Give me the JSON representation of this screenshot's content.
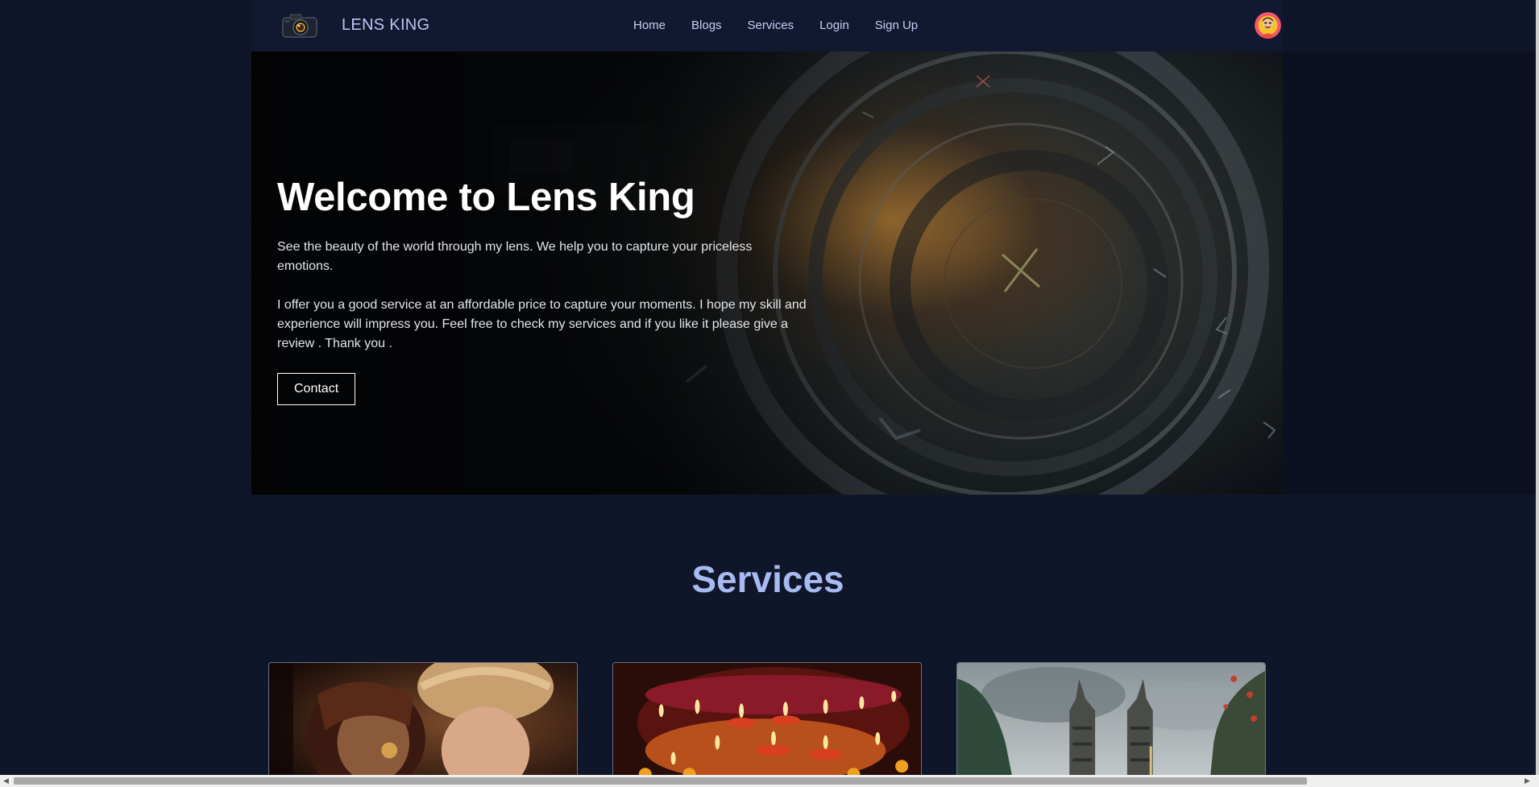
{
  "navbar": {
    "brand_name": "LENS KING",
    "links": [
      "Home",
      "Blogs",
      "Services",
      "Login",
      "Sign Up"
    ]
  },
  "hero": {
    "title": "Welcome to Lens King",
    "paragraph1": "See the beauty of the world through my lens. We help you to capture your priceless emotions.",
    "paragraph2": "I offer you a good service at an affordable price to capture your moments. I hope my skill and experience will impress you. Feel free to check my services and if you like it please give a review . Thank you .",
    "button_label": "Contact"
  },
  "services": {
    "heading": "Services"
  },
  "colors": {
    "page_background": "#101629",
    "navbar_background": "#111830",
    "accent_heading": "#a7bbf2",
    "nav_text": "#c4d0f3"
  }
}
